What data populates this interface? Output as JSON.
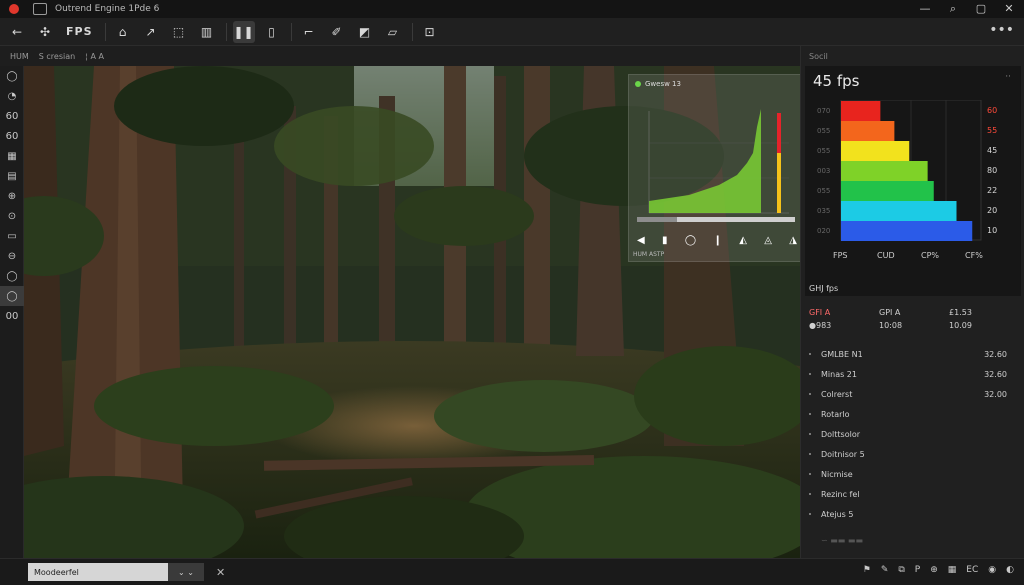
{
  "titlebar": {
    "title": "Outrend Engine 1Pde 6",
    "controls": {
      "minimize": "—",
      "search": "⌕",
      "maximize": "▢",
      "close": "✕"
    }
  },
  "toolbar": {
    "fps_label": "FPS",
    "buttons": [
      "back-icon",
      "fps-tool",
      "edit-icon",
      "select-icon",
      "pin-icon",
      "layers-icon",
      "split-icon",
      "crop-icon",
      "brush-icon",
      "measure-icon",
      "frame-icon",
      "tablet-icon",
      "record-icon"
    ],
    "more": "•••"
  },
  "subbar": {
    "left": "HUM",
    "mode": "S cresian",
    "glyphs": "¦ A A"
  },
  "leftbar": {
    "items": [
      "◯",
      "◔",
      "60",
      "60",
      "▦",
      "▤",
      "⊕",
      "⊙",
      "▭",
      "⊖",
      "◯",
      "◯",
      "00"
    ]
  },
  "graph_overlay": {
    "title": "Gwesw 13",
    "footer": "HUM ASTP",
    "controls": [
      "◀",
      "▮",
      "◯",
      "❙",
      "◭",
      "◬",
      "◮"
    ]
  },
  "right_panel": {
    "header": "Socil",
    "fps_value": "45 fps",
    "more": "··",
    "chart_data": {
      "type": "bar",
      "orientation": "horizontal",
      "categories": [
        "FPS",
        "CUD",
        "CP%",
        "CF%"
      ],
      "left_ticks": [
        "070",
        "055",
        "055",
        "003",
        "055",
        "035",
        "020"
      ],
      "right_ticks": [
        "60",
        "55",
        "45",
        "80",
        "22",
        "20",
        "10"
      ],
      "bars": [
        {
          "value": 0.45,
          "color": "#e8241e"
        },
        {
          "value": 0.61,
          "color": "#f3661c"
        },
        {
          "value": 0.78,
          "color": "#f2e21d"
        },
        {
          "value": 0.99,
          "color": "#7fd228"
        },
        {
          "value": 1.06,
          "color": "#22c24a"
        },
        {
          "value": 1.32,
          "color": "#1ccbe5"
        },
        {
          "value": 1.5,
          "color": "#2b5be8"
        }
      ]
    },
    "section_title": "GHJ fps",
    "stats": [
      [
        "GFI A",
        "GPI A",
        "£1.53"
      ],
      [
        "●983",
        "10:08",
        "10.09"
      ]
    ],
    "list": [
      {
        "label": "GMLBE N1",
        "value": "32.60"
      },
      {
        "label": "Minas 21",
        "value": "32.60"
      },
      {
        "label": "Colrerst",
        "value": "32.00"
      },
      {
        "label": "Rotarlo",
        "value": ""
      },
      {
        "label": "Dolttsolor",
        "value": ""
      },
      {
        "label": "Doitnisor 5",
        "value": ""
      },
      {
        "label": "Nicmise",
        "value": ""
      },
      {
        "label": "Rezinc fel",
        "value": ""
      },
      {
        "label": "Atejus 5",
        "value": ""
      }
    ],
    "list_tail": "∽ ▬▬ ▬▬"
  },
  "statusbar": {
    "field_value": "Moodeerfel",
    "dropdown": "⌄ ⌄",
    "close": "✕",
    "right": [
      "⚑",
      "✎",
      "⧉",
      "P",
      "⊕",
      "▦",
      "EC",
      "◉",
      "◐"
    ]
  }
}
